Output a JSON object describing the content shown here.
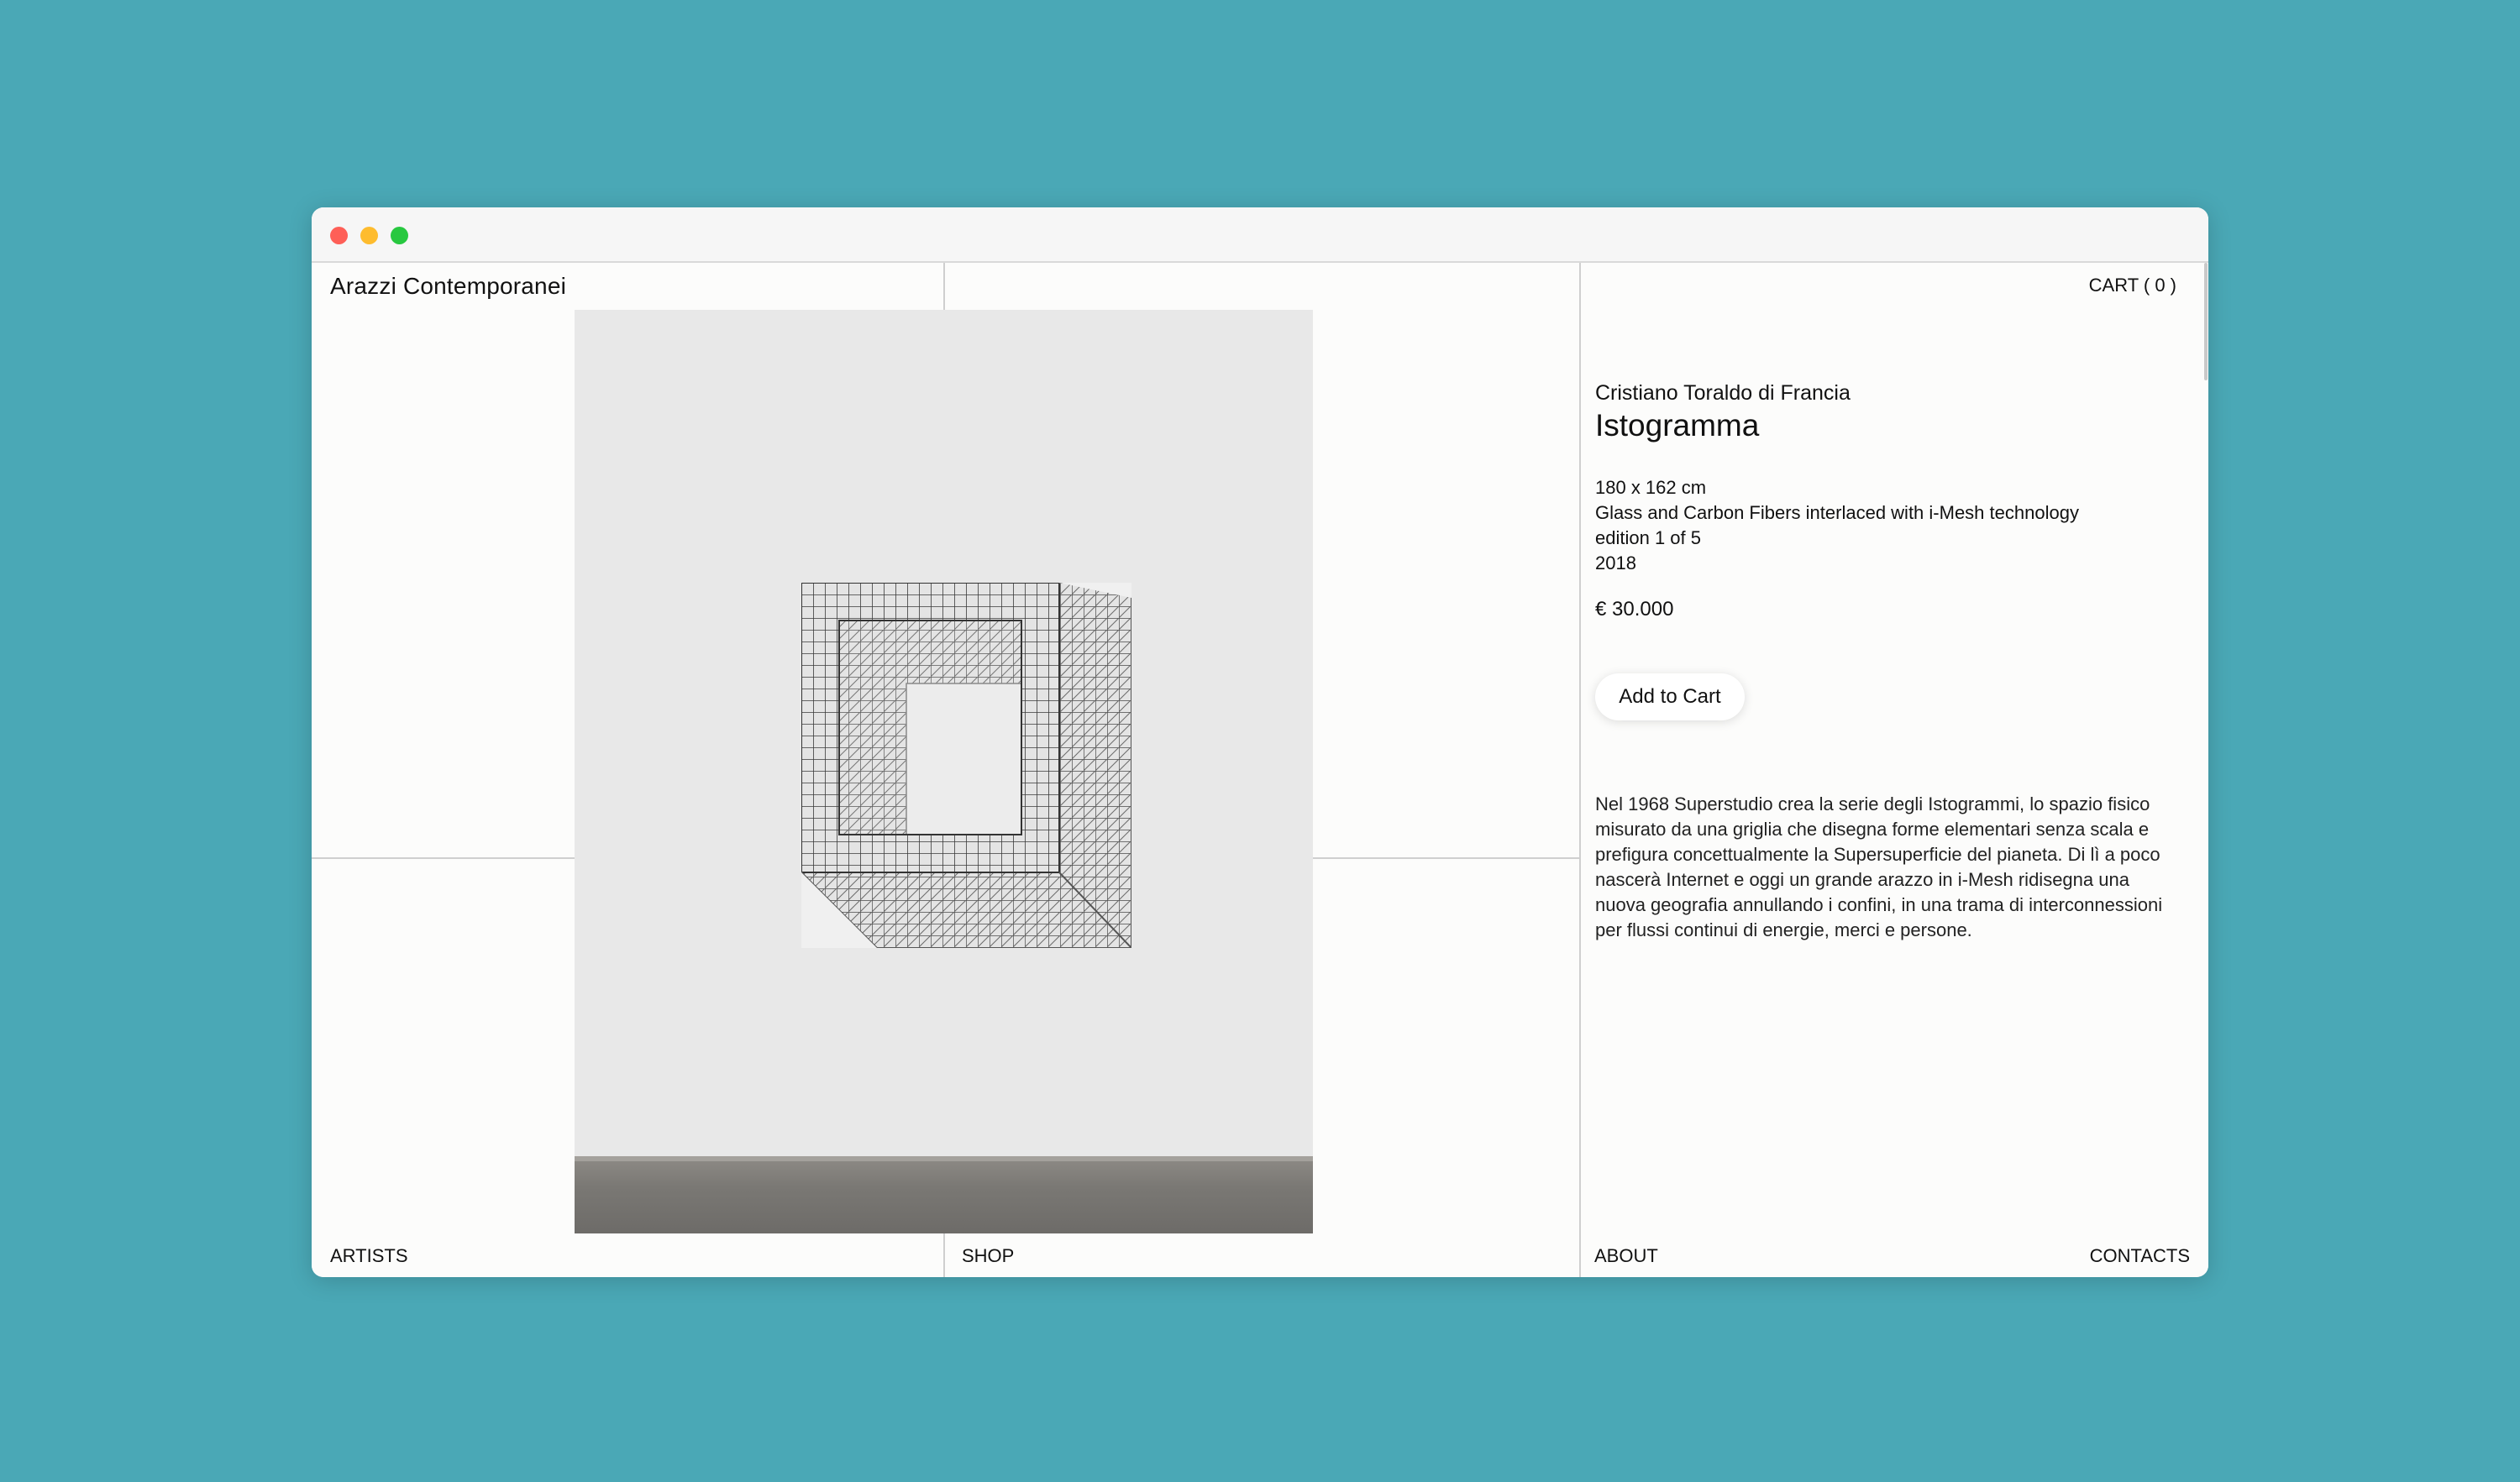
{
  "site": {
    "title": "Arazzi Contemporanei",
    "cart_label": "CART ( 0 )"
  },
  "product": {
    "artist": "Cristiano Toraldo di Francia",
    "title": "Istogramma",
    "dimensions": "180 x 162 cm",
    "material": "Glass and Carbon Fibers interlaced with i-Mesh technology",
    "edition": "edition 1 of 5",
    "year": "2018",
    "price": "€ 30.000",
    "add_to_cart_label": "Add to Cart",
    "description": "Nel 1968 Superstudio crea la serie degli Istogrammi, lo spazio fisico misurato da una griglia che disegna forme elementari senza scala e prefigura concettualmente la Supersuperficie del pianeta. Di lì a poco nascerà Internet e oggi un grande arazzo in i-Mesh ridisegna una nuova geografia annullando i confini, in una trama di interconnessioni per flussi continui di energie, merci e persone."
  },
  "nav": {
    "artists": "ARTISTS",
    "shop": "SHOP",
    "about": "ABOUT",
    "contacts": "CONTACTS"
  },
  "colors": {
    "background": "#4aa8b6",
    "page": "#fcfcfb",
    "divider": "#cfcfcf"
  },
  "icons": {
    "window_close": "red-dot",
    "window_minimize": "yellow-dot",
    "window_zoom": "green-dot"
  }
}
